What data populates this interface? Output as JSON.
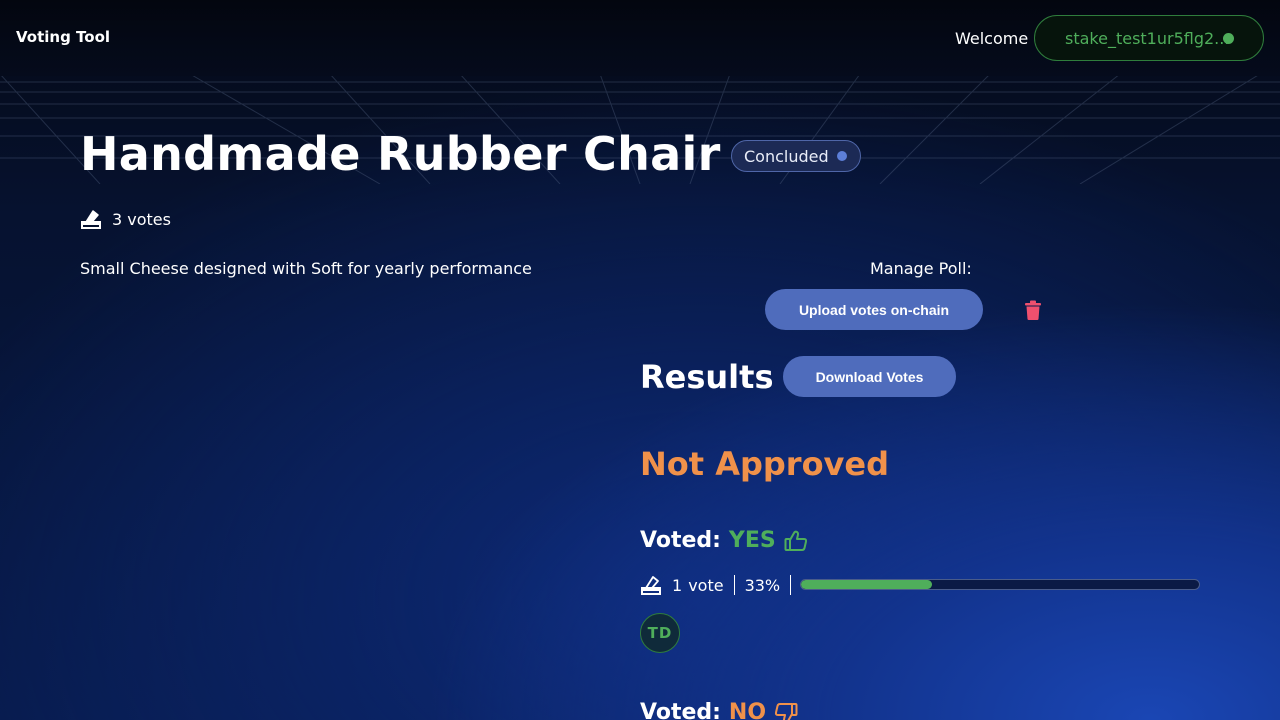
{
  "header": {
    "brand": "Voting Tool",
    "welcome": "Welcome",
    "stake_address": "stake_test1ur5flg2...",
    "status_color": "#4fae5b"
  },
  "poll": {
    "title": "Handmade Rubber Chair",
    "status": "Concluded",
    "votes_count": "3 votes",
    "description": "Small Cheese designed with Soft for yearly performance"
  },
  "manage": {
    "label": "Manage Poll:",
    "upload_label": "Upload votes on-chain",
    "delete_icon": "trash-icon"
  },
  "results": {
    "title": "Results",
    "download_label": "Download Votes",
    "outcome": "Not Approved",
    "outcome_color": "#f0914a",
    "yes": {
      "label": "Voted:",
      "value": "YES",
      "vote_count": "1",
      "vote_word": "vote",
      "percent": "33%",
      "progress": 0.33,
      "voters": [
        "TD"
      ]
    },
    "no": {
      "label": "Voted:",
      "value": "NO"
    }
  }
}
